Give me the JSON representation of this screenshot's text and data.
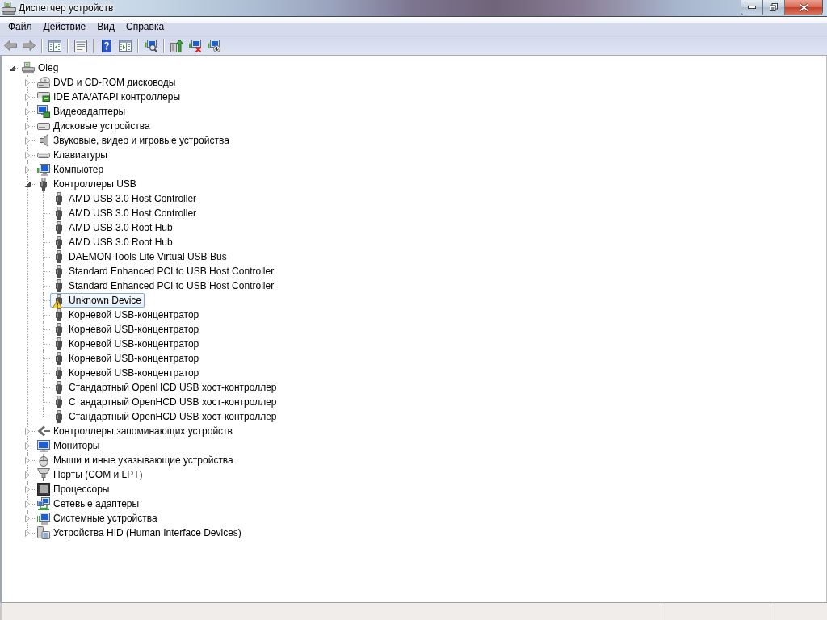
{
  "window": {
    "title": "Диспетчер устройств"
  },
  "menu": [
    "Файл",
    "Действие",
    "Вид",
    "Справка"
  ],
  "toolbar": [
    [
      {
        "kind": "back",
        "disabled": true
      },
      {
        "kind": "forward",
        "disabled": true
      }
    ],
    [
      {
        "kind": "console_tree",
        "disabled": false
      }
    ],
    [
      {
        "kind": "properties",
        "disabled": false
      }
    ],
    [
      {
        "kind": "help",
        "disabled": false
      },
      {
        "kind": "action_pane",
        "disabled": false
      }
    ],
    [
      {
        "kind": "scan",
        "disabled": false
      }
    ],
    [
      {
        "kind": "update_driver",
        "disabled": false
      },
      {
        "kind": "disable",
        "disabled": false
      },
      {
        "kind": "uninstall",
        "disabled": false
      }
    ]
  ],
  "tree": {
    "label": "Oleg",
    "kind": "computer_root",
    "expanded": true,
    "selected": false,
    "warning": false,
    "children": [
      {
        "label": "DVD и CD-ROM дисководы",
        "kind": "dvd",
        "expanded": false,
        "selected": false,
        "warning": false
      },
      {
        "label": "IDE ATA/ATAPI контроллеры",
        "kind": "ide",
        "expanded": false,
        "selected": false,
        "warning": false
      },
      {
        "label": "Видеоадаптеры",
        "kind": "display",
        "expanded": false,
        "selected": false,
        "warning": false
      },
      {
        "label": "Дисковые устройства",
        "kind": "disk",
        "expanded": false,
        "selected": false,
        "warning": false
      },
      {
        "label": "Звуковые, видео и игровые устройства",
        "kind": "sound",
        "expanded": false,
        "selected": false,
        "warning": false
      },
      {
        "label": "Клавиатуры",
        "kind": "keyboard",
        "expanded": false,
        "selected": false,
        "warning": false
      },
      {
        "label": "Компьютер",
        "kind": "computer",
        "expanded": false,
        "selected": false,
        "warning": false
      },
      {
        "label": "Контроллеры USB",
        "kind": "usb",
        "expanded": true,
        "selected": false,
        "warning": false,
        "children": [
          {
            "label": "AMD USB 3.0 Host Controller",
            "kind": "usb",
            "selected": false,
            "warning": false
          },
          {
            "label": "AMD USB 3.0 Host Controller",
            "kind": "usb",
            "selected": false,
            "warning": false
          },
          {
            "label": "AMD USB 3.0 Root Hub",
            "kind": "usb",
            "selected": false,
            "warning": false
          },
          {
            "label": "AMD USB 3.0 Root Hub",
            "kind": "usb",
            "selected": false,
            "warning": false
          },
          {
            "label": "DAEMON Tools Lite Virtual USB Bus",
            "kind": "usb",
            "selected": false,
            "warning": false
          },
          {
            "label": "Standard Enhanced PCI to USB Host Controller",
            "kind": "usb",
            "selected": false,
            "warning": false
          },
          {
            "label": "Standard Enhanced PCI to USB Host Controller",
            "kind": "usb",
            "selected": false,
            "warning": false
          },
          {
            "label": "Unknown Device",
            "kind": "usb",
            "selected": true,
            "warning": true
          },
          {
            "label": "Корневой USB-концентратор",
            "kind": "usb",
            "selected": false,
            "warning": false
          },
          {
            "label": "Корневой USB-концентратор",
            "kind": "usb",
            "selected": false,
            "warning": false
          },
          {
            "label": "Корневой USB-концентратор",
            "kind": "usb",
            "selected": false,
            "warning": false
          },
          {
            "label": "Корневой USB-концентратор",
            "kind": "usb",
            "selected": false,
            "warning": false
          },
          {
            "label": "Корневой USB-концентратор",
            "kind": "usb",
            "selected": false,
            "warning": false
          },
          {
            "label": "Стандартный OpenHCD USB хост-контроллер",
            "kind": "usb",
            "selected": false,
            "warning": false
          },
          {
            "label": "Стандартный OpenHCD USB хост-контроллер",
            "kind": "usb",
            "selected": false,
            "warning": false
          },
          {
            "label": "Стандартный OpenHCD USB хост-контроллер",
            "kind": "usb",
            "selected": false,
            "warning": false
          }
        ]
      },
      {
        "label": "Контроллеры запоминающих устройств",
        "kind": "storage",
        "expanded": false,
        "selected": false,
        "warning": false
      },
      {
        "label": "Мониторы",
        "kind": "monitor",
        "expanded": false,
        "selected": false,
        "warning": false
      },
      {
        "label": "Мыши и иные указывающие устройства",
        "kind": "mouse",
        "expanded": false,
        "selected": false,
        "warning": false
      },
      {
        "label": "Порты (COM и LPT)",
        "kind": "port",
        "expanded": false,
        "selected": false,
        "warning": false
      },
      {
        "label": "Процессоры",
        "kind": "cpu",
        "expanded": false,
        "selected": false,
        "warning": false
      },
      {
        "label": "Сетевые адаптеры",
        "kind": "network",
        "expanded": false,
        "selected": false,
        "warning": false
      },
      {
        "label": "Системные устройства",
        "kind": "system",
        "expanded": false,
        "selected": false,
        "warning": false
      },
      {
        "label": "Устройства HID (Human Interface Devices)",
        "kind": "hid",
        "expanded": false,
        "selected": false,
        "warning": false
      }
    ]
  }
}
